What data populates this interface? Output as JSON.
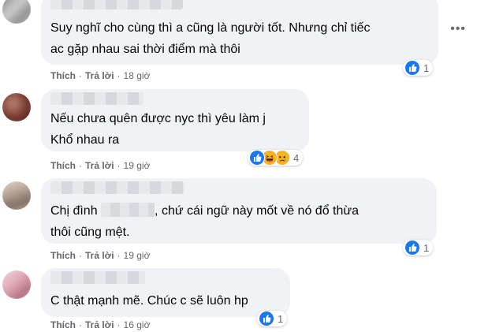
{
  "options_icon": "more-options-icon",
  "comments": [
    {
      "lines": [
        "Suy nghĩ cho cùng thì a cũng là người tốt. Nhưng chỉ tiếc",
        "ac gặp nhau sai thời điểm mà thôi"
      ],
      "like": "Thích",
      "reply": "Trả lời",
      "time": "18 giờ",
      "reactions": [
        "like"
      ],
      "reaction_count": "1"
    },
    {
      "lines": [
        "Nếu chưa quên được nyc thì yêu làm j",
        "Khổ nhau ra"
      ],
      "like": "Thích",
      "reply": "Trả lời",
      "time": "19 giờ",
      "reactions": [
        "like",
        "haha",
        "sad"
      ],
      "reaction_count": "4"
    },
    {
      "line1_before": "Chị đình",
      "line1_after": ", chứ cái ngữ này mốt về nó đổ thừa",
      "line2": "thôi cũng mệt.",
      "like": "Thích",
      "reply": "Trả lời",
      "time": "19 giờ",
      "reactions": [
        "like"
      ],
      "reaction_count": "1"
    },
    {
      "lines": [
        "C thật mạnh mẽ. Chúc c sẽ luôn hp"
      ],
      "like": "Thích",
      "reply": "Trả lời",
      "time": "16 giờ",
      "reactions": [
        "like"
      ],
      "reaction_count": "1"
    }
  ],
  "colors": {
    "bubble": "#f0f2f5",
    "meta": "#65676b",
    "like_blue": "#1877f2",
    "emoji_yellow": "#f7b125"
  }
}
